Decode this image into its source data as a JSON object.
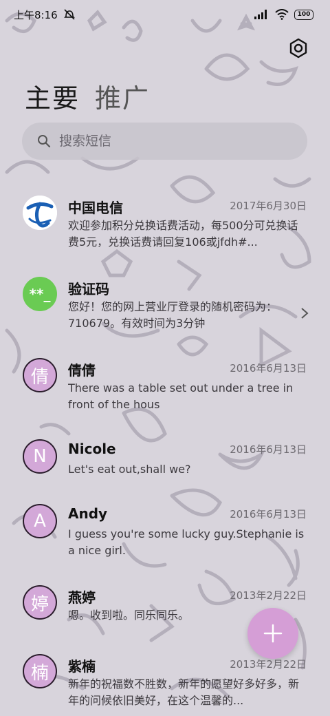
{
  "status_bar": {
    "time": "上午8:16",
    "battery": "100"
  },
  "tabs": [
    {
      "label": "主要",
      "active": true
    },
    {
      "label": "推广",
      "active": false
    }
  ],
  "search": {
    "placeholder": "搜索短信"
  },
  "conversations": [
    {
      "name": "中国电信",
      "date": "2017年6月30日",
      "preview": "欢迎参加积分兑换话费活动，每500分可兑换话费5元，兑换话费请回复106或jfdh#...",
      "avatar_type": "telecom-logo"
    },
    {
      "name": "验证码",
      "date": "",
      "preview": "您好！您的网上营业厅登录的随机密码为：710679。有效时间为3分钟",
      "avatar_text": "**_",
      "avatar_type": "code"
    },
    {
      "name": "倩倩",
      "date": "2016年6月13日",
      "preview": "There was a table set out under a tree in front of the hous",
      "avatar_text": "倩"
    },
    {
      "name": "Nicole",
      "date": "2016年6月13日",
      "preview": "Let's eat out,shall we?",
      "avatar_text": "N"
    },
    {
      "name": "Andy",
      "date": "2016年6月13日",
      "preview": "I guess you're some lucky guy.Stephanie is a nice girl.",
      "avatar_text": "A"
    },
    {
      "name": "燕婷",
      "date": "2013年2月22日",
      "preview": "嗯。收到啦。同乐同乐。",
      "avatar_text": "婷"
    },
    {
      "name": "紫楠",
      "date": "2013年2月22日",
      "preview": "新年的祝福数不胜数，新年的愿望好多好多，新年的问候依旧美好，在这个温馨的...",
      "avatar_text": "楠"
    }
  ],
  "fab": {
    "icon": "plus-icon"
  },
  "colors": {
    "accent": "#d59ed6",
    "avatar": "#d3a8d8",
    "code_avatar": "#6acb53"
  }
}
